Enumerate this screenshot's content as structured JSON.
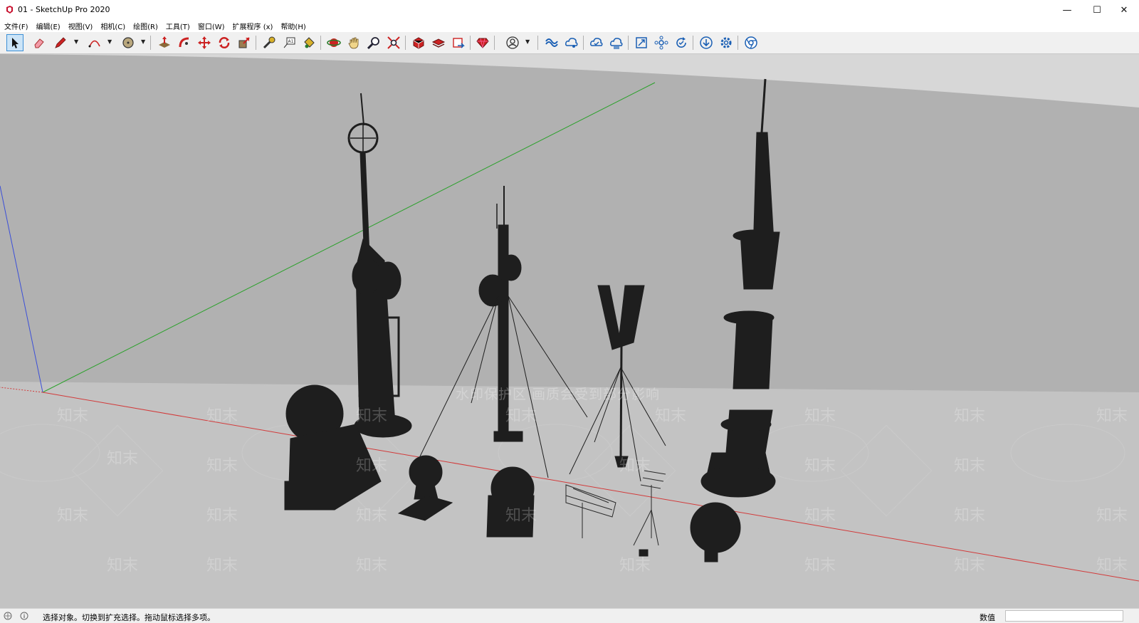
{
  "window": {
    "title": "01 - SketchUp Pro 2020",
    "minimize_glyph": "—",
    "maximize_glyph": "☐",
    "close_glyph": "✕"
  },
  "menu": {
    "items": [
      {
        "label": "文件(F)"
      },
      {
        "label": "编辑(E)"
      },
      {
        "label": "视图(V)"
      },
      {
        "label": "相机(C)"
      },
      {
        "label": "绘图(R)"
      },
      {
        "label": "工具(T)"
      },
      {
        "label": "窗口(W)"
      },
      {
        "label": "扩展程序 (x)"
      },
      {
        "label": "帮助(H)"
      }
    ]
  },
  "toolbar": {
    "tools": [
      "select-icon",
      "eraser-icon",
      "pencil-icon",
      "arc-icon",
      "circle-icon",
      "push-pull-icon",
      "follow-me-icon",
      "move-icon",
      "rotate-icon",
      "scale-icon",
      "tape-measure-icon",
      "text-icon",
      "paint-bucket-icon",
      "orbit-icon",
      "pan-icon",
      "zoom-icon",
      "zoom-extents-icon",
      "warehouse-icon",
      "extension-warehouse-icon",
      "layout-icon",
      "ruby-icon",
      "account-icon",
      "trimble-connect-icon",
      "share-icon",
      "cloud-sync-icon",
      "cloud-upload-icon",
      "bim-icon",
      "model-info-icon",
      "refresh-icon",
      "download-icon",
      "settings-icon",
      "chrome-icon"
    ]
  },
  "viewport": {
    "watermark": "水印保护区 画质会受到部分影响",
    "watermark_brand": "知末",
    "background_color": "#b1b1b1",
    "ground_color": "#c2c2c2"
  },
  "status": {
    "message": "选择对象。切换到扩充选择。拖动鼠标选择多项。",
    "value_label": "数值",
    "value": ""
  }
}
